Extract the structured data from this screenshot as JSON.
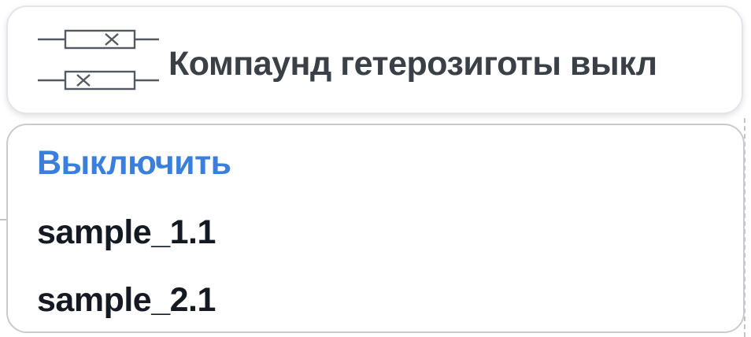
{
  "dropdown": {
    "icon": "compound-heterozygote-icon",
    "selected_label": "Компаунд гетерозиготы выкл",
    "options": [
      {
        "label": "Выключить",
        "state": "selected",
        "color": "#3a7fde"
      },
      {
        "label": "sample_1.1",
        "state": "normal"
      },
      {
        "label": "sample_2.1",
        "state": "normal"
      }
    ]
  }
}
